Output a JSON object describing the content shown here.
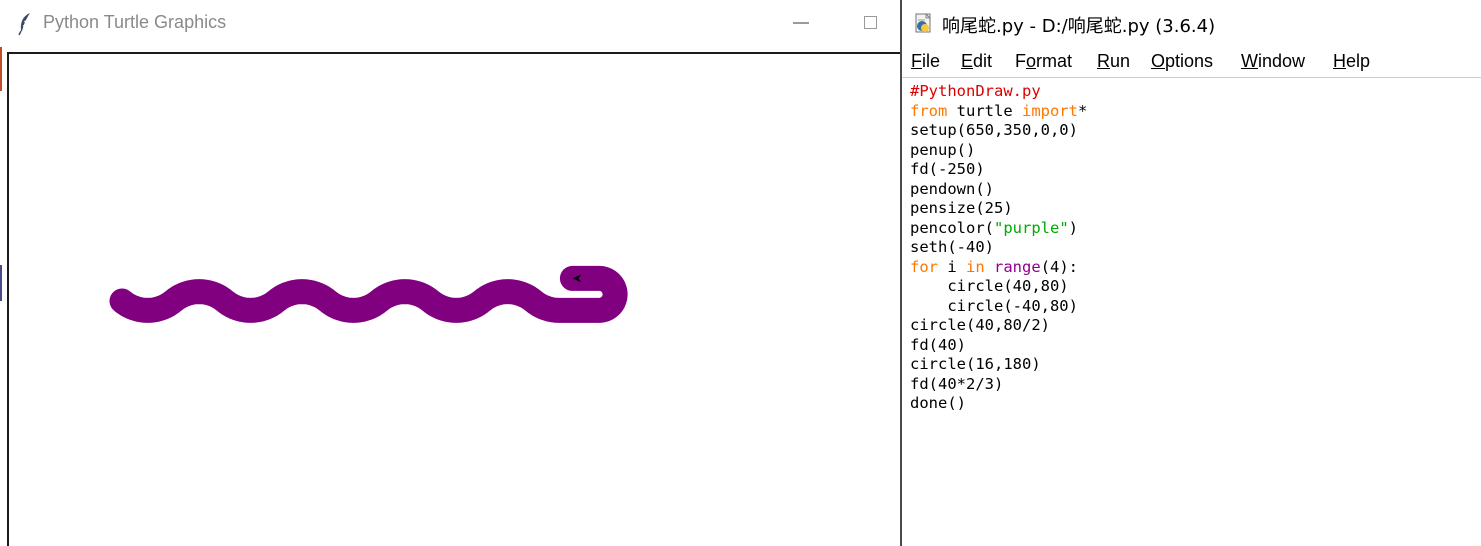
{
  "turtle_window": {
    "title": "Python Turtle Graphics",
    "icon": "feather-icon",
    "pen_color": "#800080",
    "canvas_bg": "#ffffff"
  },
  "idle_window": {
    "title": "响尾蛇.py - D:/响尾蛇.py (3.6.4)",
    "icon": "python-file-icon",
    "menu": [
      {
        "label": "File",
        "underline_index": 0
      },
      {
        "label": "Edit",
        "underline_index": 0
      },
      {
        "label": "Format",
        "underline_index": 1
      },
      {
        "label": "Run",
        "underline_index": 0
      },
      {
        "label": "Options",
        "underline_index": 0
      },
      {
        "label": "Window",
        "underline_index": 0
      },
      {
        "label": "Help",
        "underline_index": 0
      }
    ],
    "code_lines": [
      [
        {
          "t": "#PythonDraw.py",
          "c": "cm"
        }
      ],
      [
        {
          "t": "from",
          "c": "kw"
        },
        {
          "t": " turtle "
        },
        {
          "t": "import",
          "c": "kw"
        },
        {
          "t": "*"
        }
      ],
      [
        {
          "t": "setup(650,350,0,0)"
        }
      ],
      [
        {
          "t": "penup()"
        }
      ],
      [
        {
          "t": "fd(-250)"
        }
      ],
      [
        {
          "t": "pendown()"
        }
      ],
      [
        {
          "t": "pensize(25)"
        }
      ],
      [
        {
          "t": "pencolor("
        },
        {
          "t": "\"purple\"",
          "c": "st"
        },
        {
          "t": ")"
        }
      ],
      [
        {
          "t": "seth(-40)"
        }
      ],
      [
        {
          "t": "for",
          "c": "kw"
        },
        {
          "t": " i "
        },
        {
          "t": "in",
          "c": "kw"
        },
        {
          "t": " "
        },
        {
          "t": "range",
          "c": "bi"
        },
        {
          "t": "(4):"
        }
      ],
      [
        {
          "t": "    circle(40,80)"
        }
      ],
      [
        {
          "t": "    circle(-40,80)"
        }
      ],
      [
        {
          "t": "circle(40,80/2)"
        }
      ],
      [
        {
          "t": "fd(40)"
        }
      ],
      [
        {
          "t": "circle(16,180)"
        }
      ],
      [
        {
          "t": "fd(40*2/3)"
        }
      ],
      [
        {
          "t": "done()"
        }
      ]
    ],
    "syntax_colors": {
      "keyword": "#ff7700",
      "comment": "#dd0000",
      "string": "#00aa00",
      "builtin": "#900090"
    }
  }
}
